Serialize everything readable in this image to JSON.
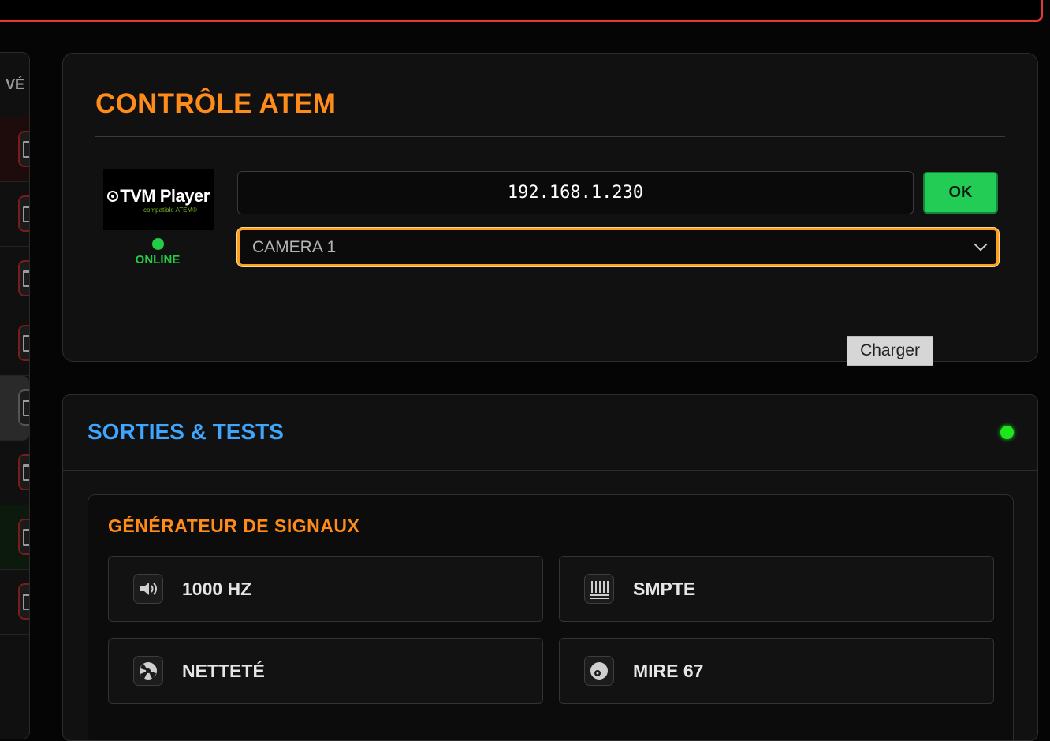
{
  "sidebar": {
    "header_fragment": "VÉ"
  },
  "atem": {
    "title": "CONTRÔLE ATEM",
    "logo": {
      "name": "TVM Player",
      "subtitle": "compatible ATEM®"
    },
    "status": "ONLINE",
    "ip_value": "192.168.1.230",
    "ok_label": "OK",
    "camera_selected": "CAMERA 1",
    "tooltip": "Charger"
  },
  "sorties": {
    "title": "SORTIES & TESTS",
    "generator": {
      "title": "GÉNÉRATEUR DE SIGNAUX",
      "buttons": [
        {
          "label": "1000 HZ",
          "icon": "speaker-icon"
        },
        {
          "label": "SMPTE",
          "icon": "color-bars-icon"
        },
        {
          "label": "NETTETÉ",
          "icon": "focus-chart-icon"
        },
        {
          "label": "MIRE 67",
          "icon": "test-pattern-icon"
        }
      ]
    }
  },
  "colors": {
    "accent_orange": "#ff8c1a",
    "accent_blue": "#3fa6ff",
    "status_green": "#22cc44",
    "alert_red": "#e53935"
  }
}
